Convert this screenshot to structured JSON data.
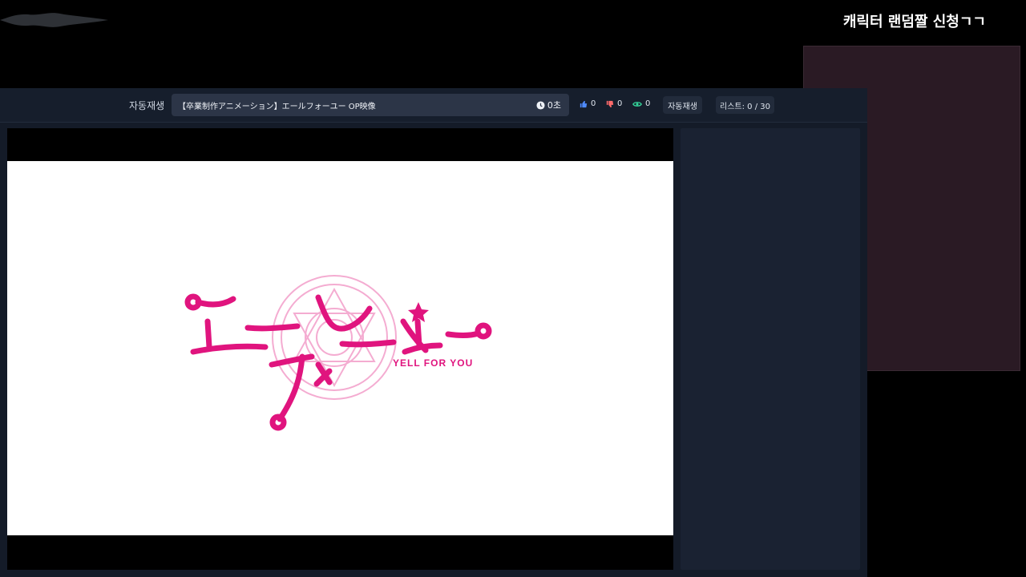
{
  "overlay": {
    "title": "캐릭터 랜덤짤 신청ㄱㄱ"
  },
  "toolbar": {
    "autoplay_label": "자동재생",
    "video_title": "【卒業制作アニメーション】エールフォーユー OP映像",
    "timer": "0초",
    "likes": "0",
    "dislikes": "0",
    "views": "0",
    "autoplay_button": "자동재생",
    "list_counter": "리스트: 0 / 30"
  },
  "video": {
    "logo_main": "エールフォーユー",
    "logo_sub": "YELL FOR YOU"
  },
  "colors": {
    "logo_pink": "#e0147e",
    "like_blue": "#4f8bff",
    "dislike_red": "#ff6b6b",
    "view_green": "#34d399"
  },
  "icons": {
    "timer": "clock-icon",
    "likes": "thumbs-up-icon",
    "dislikes": "thumbs-down-icon",
    "views": "eye-icon"
  }
}
